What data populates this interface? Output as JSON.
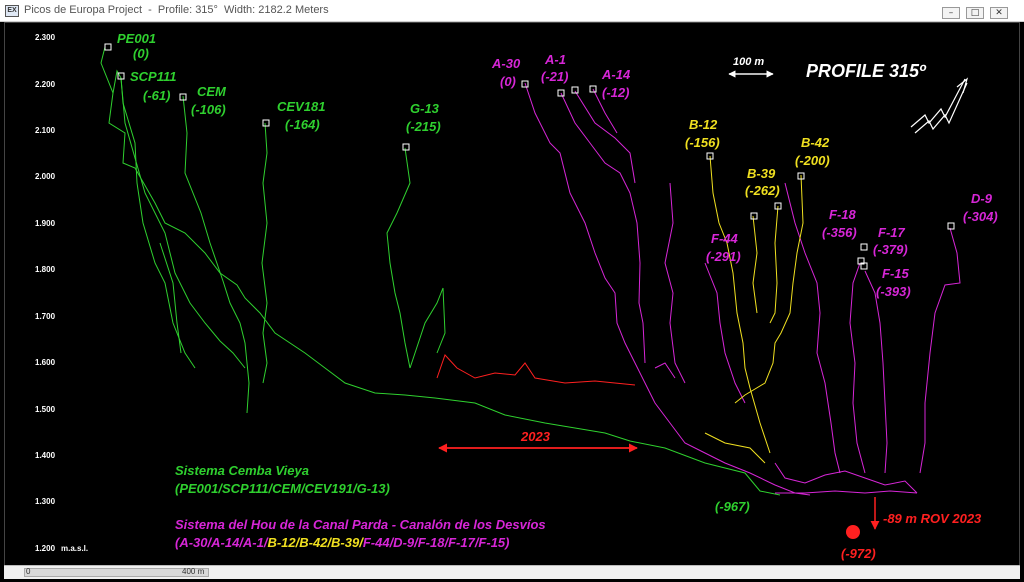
{
  "window": {
    "title": "Picos de Europa Project  -  Profile: 315°  Width: 2182.2 Meters",
    "icon_label": "EX",
    "controls": [
      "minimize-icon",
      "maximize-icon",
      "close-icon"
    ]
  },
  "plot": {
    "heading": "PROFILE 315º",
    "scale_label": "100 m",
    "year_label": "2023",
    "rov_label": "-89 m ROV 2023",
    "depth_label": "(-972)",
    "end_label": "(-967)",
    "axis_unit": "m.a.s.l.",
    "elevation_ticks": [
      "2.300",
      "2.200",
      "2.100",
      "2.000",
      "1.900",
      "1.800",
      "1.700",
      "1.600",
      "1.500",
      "1.400",
      "1.300",
      "1.200"
    ],
    "colors": {
      "green": "#2fd02f",
      "magenta": "#d726d7",
      "yellow": "#f0e020",
      "red": "#ff2020",
      "white": "#ffffff"
    }
  },
  "entrances": [
    {
      "name": "PE001",
      "depth": "(0)",
      "color": "green"
    },
    {
      "name": "SCP111",
      "depth": "(-61)",
      "color": "green"
    },
    {
      "name": "CEM",
      "depth": "(-106)",
      "color": "green"
    },
    {
      "name": "CEV181",
      "depth": "(-164)",
      "color": "green"
    },
    {
      "name": "G-13",
      "depth": "(-215)",
      "color": "green"
    },
    {
      "name": "A-30",
      "depth": "(0)",
      "color": "magenta"
    },
    {
      "name": "A-1",
      "depth": "(-21)",
      "color": "magenta"
    },
    {
      "name": "A-14",
      "depth": "(-12)",
      "color": "magenta"
    },
    {
      "name": "B-12",
      "depth": "(-156)",
      "color": "yellow"
    },
    {
      "name": "B-42",
      "depth": "(-200)",
      "color": "yellow"
    },
    {
      "name": "B-39",
      "depth": "(-262)",
      "color": "yellow"
    },
    {
      "name": "F-44",
      "depth": "(-291)",
      "color": "magenta"
    },
    {
      "name": "F-18",
      "depth": "(-356)",
      "color": "magenta"
    },
    {
      "name": "F-17",
      "depth": "(-379)",
      "color": "magenta"
    },
    {
      "name": "F-15",
      "depth": "(-393)",
      "color": "magenta"
    },
    {
      "name": "D-9",
      "depth": "(-304)",
      "color": "magenta"
    }
  ],
  "legend": {
    "system1_name": "Sistema Cemba Vieya",
    "system1_members": "(PE001/SCP111/CEM/CEV191/G-13)",
    "system2_name": "Sistema del Hou de la Canal Parda - Canalón de los Desvíos",
    "system2_members_a": "(A-30/A-14/A-1/",
    "system2_members_b": "B-12/B-42/B-39/",
    "system2_members_c": "F-44/D-9/F-18/F-17/F-15)"
  },
  "scrollbar": {
    "start_label": "0",
    "end_label": "400 m"
  }
}
